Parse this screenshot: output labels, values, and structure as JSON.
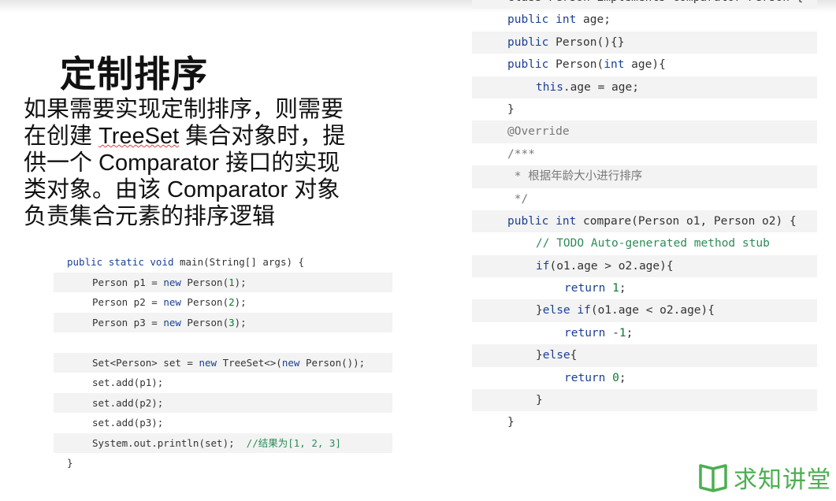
{
  "slide": {
    "title": "定制排序",
    "description_lines": [
      "如果需要实现定制排序，则需要",
      "在创建 ",
      "TreeSet",
      " 集合对象时，提",
      "供一个 Comparator 接口的实现",
      "类对象。由该 Comparator 对象",
      "负责集合元素的排序逻辑"
    ]
  },
  "left_code": {
    "lines": [
      {
        "indent": 0,
        "tokens": [
          [
            "kw",
            "public"
          ],
          [
            "t",
            " "
          ],
          [
            "kw",
            "static"
          ],
          [
            "t",
            " "
          ],
          [
            "kw",
            "void"
          ],
          [
            "t",
            " main(String[] args) {"
          ]
        ]
      },
      {
        "indent": 1,
        "tokens": [
          [
            "t",
            "Person p1 = "
          ],
          [
            "kw",
            "new"
          ],
          [
            "t",
            " Person("
          ],
          [
            "num",
            "1"
          ],
          [
            "t",
            ");"
          ]
        ]
      },
      {
        "indent": 1,
        "tokens": [
          [
            "t",
            "Person p2 = "
          ],
          [
            "kw",
            "new"
          ],
          [
            "t",
            " Person("
          ],
          [
            "num",
            "2"
          ],
          [
            "t",
            ");"
          ]
        ]
      },
      {
        "indent": 1,
        "tokens": [
          [
            "t",
            "Person p3 = "
          ],
          [
            "kw",
            "new"
          ],
          [
            "t",
            " Person("
          ],
          [
            "num",
            "3"
          ],
          [
            "t",
            ");"
          ]
        ]
      },
      {
        "indent": 1,
        "tokens": []
      },
      {
        "indent": 1,
        "tokens": [
          [
            "t",
            "Set<Person> set = "
          ],
          [
            "kw",
            "new"
          ],
          [
            "t",
            " TreeSet<>("
          ],
          [
            "kw",
            "new"
          ],
          [
            "t",
            " Person());"
          ]
        ]
      },
      {
        "indent": 1,
        "tokens": [
          [
            "t",
            "set.add(p1);"
          ]
        ]
      },
      {
        "indent": 1,
        "tokens": [
          [
            "t",
            "set.add(p2);"
          ]
        ]
      },
      {
        "indent": 1,
        "tokens": [
          [
            "t",
            "set.add(p3);"
          ]
        ]
      },
      {
        "indent": 1,
        "tokens": [
          [
            "t",
            "System.out.println(set);  "
          ],
          [
            "cm",
            "//结果为[1, 2, 3]"
          ]
        ]
      },
      {
        "indent": 0,
        "tokens": [
          [
            "t",
            "}"
          ]
        ]
      }
    ]
  },
  "right_code": {
    "lines": [
      {
        "indent": 0,
        "tokens": [
          [
            "t",
            "class Person implements Comparator<Person>{"
          ]
        ]
      },
      {
        "indent": 0,
        "tokens": [
          [
            "kw",
            "public"
          ],
          [
            "t",
            " "
          ],
          [
            "typ",
            "int"
          ],
          [
            "t",
            " age;"
          ]
        ]
      },
      {
        "indent": 0,
        "tokens": [
          [
            "kw",
            "public"
          ],
          [
            "t",
            " Person(){}"
          ]
        ]
      },
      {
        "indent": 0,
        "tokens": [
          [
            "kw",
            "public"
          ],
          [
            "t",
            " Person("
          ],
          [
            "typ",
            "int"
          ],
          [
            "t",
            " age){"
          ]
        ]
      },
      {
        "indent": 1,
        "tokens": [
          [
            "kw",
            "this"
          ],
          [
            "t",
            ".age = age;"
          ]
        ]
      },
      {
        "indent": 0,
        "tokens": [
          [
            "t",
            "}"
          ]
        ]
      },
      {
        "indent": 0,
        "tokens": [
          [
            "ann",
            "@Override"
          ]
        ]
      },
      {
        "indent": 0,
        "tokens": [
          [
            "doc",
            "/***"
          ]
        ]
      },
      {
        "indent": 0,
        "tokens": [
          [
            "doc",
            " * 根据年龄大小进行排序"
          ]
        ]
      },
      {
        "indent": 0,
        "tokens": [
          [
            "doc",
            " */"
          ]
        ]
      },
      {
        "indent": 0,
        "tokens": [
          [
            "kw",
            "public"
          ],
          [
            "t",
            " "
          ],
          [
            "typ",
            "int"
          ],
          [
            "t",
            " compare(Person o1, Person o2) {"
          ]
        ]
      },
      {
        "indent": 1,
        "tokens": [
          [
            "cm",
            "// TODO Auto-generated method stub"
          ]
        ]
      },
      {
        "indent": 1,
        "tokens": [
          [
            "kw",
            "if"
          ],
          [
            "t",
            "(o1.age > o2.age){"
          ]
        ]
      },
      {
        "indent": 2,
        "tokens": [
          [
            "kw",
            "return"
          ],
          [
            "t",
            " "
          ],
          [
            "num",
            "1"
          ],
          [
            "t",
            ";"
          ]
        ]
      },
      {
        "indent": 1,
        "tokens": [
          [
            "t",
            "}"
          ],
          [
            "kw",
            "else"
          ],
          [
            "t",
            " "
          ],
          [
            "kw",
            "if"
          ],
          [
            "t",
            "(o1.age < o2.age){"
          ]
        ]
      },
      {
        "indent": 2,
        "tokens": [
          [
            "kw",
            "return"
          ],
          [
            "t",
            " -"
          ],
          [
            "num",
            "1"
          ],
          [
            "t",
            ";"
          ]
        ]
      },
      {
        "indent": 1,
        "tokens": [
          [
            "t",
            "}"
          ],
          [
            "kw",
            "else"
          ],
          [
            "t",
            "{"
          ]
        ]
      },
      {
        "indent": 2,
        "tokens": [
          [
            "kw",
            "return"
          ],
          [
            "t",
            " "
          ],
          [
            "num",
            "0"
          ],
          [
            "t",
            ";"
          ]
        ]
      },
      {
        "indent": 1,
        "tokens": [
          [
            "t",
            "}"
          ]
        ]
      },
      {
        "indent": 0,
        "tokens": [
          [
            "t",
            "}"
          ]
        ]
      }
    ]
  },
  "logo": {
    "text": "求知讲堂",
    "icon": "open-book-icon",
    "color": "#4caf50"
  }
}
